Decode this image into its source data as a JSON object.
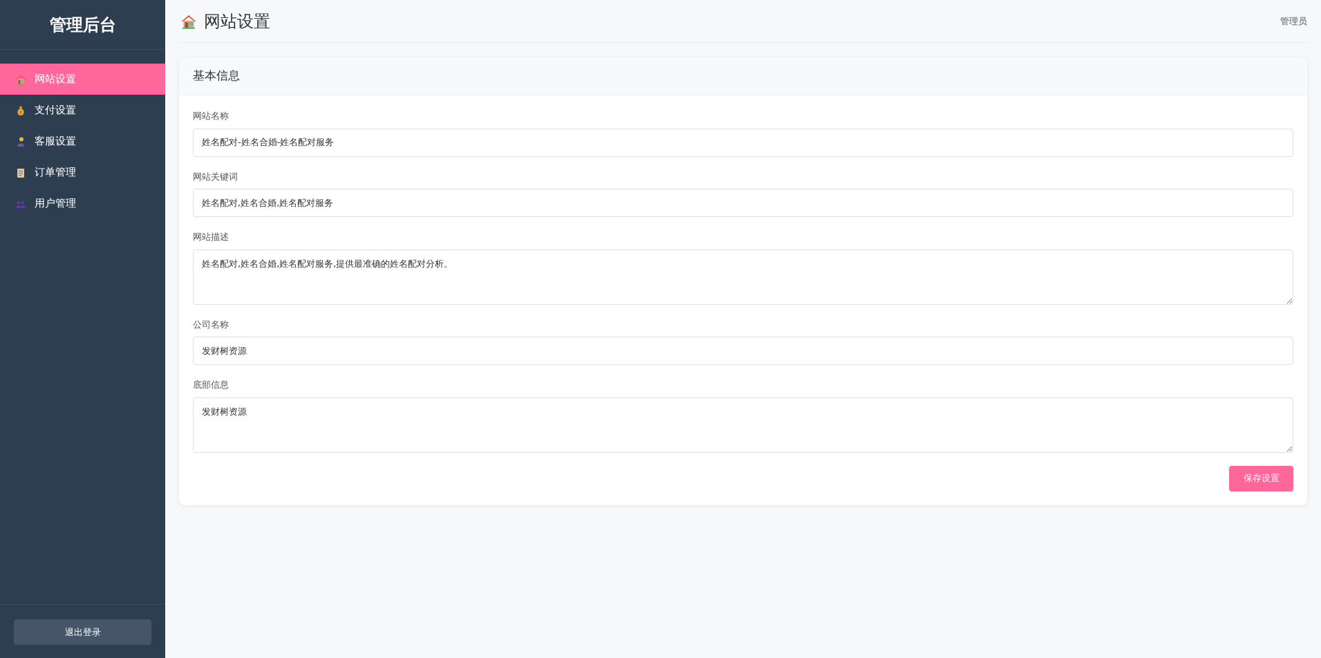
{
  "sidebar": {
    "title": "管理后台",
    "items": [
      {
        "label": "网站设置",
        "selected": true
      },
      {
        "label": "支付设置",
        "selected": false
      },
      {
        "label": "客服设置",
        "selected": false
      },
      {
        "label": "订单管理",
        "selected": false
      },
      {
        "label": "用户管理",
        "selected": false
      }
    ],
    "logout": "退出登录"
  },
  "header": {
    "title": "网站设置",
    "user": "管理员"
  },
  "card": {
    "title": "基本信息",
    "fields": [
      {
        "label": "网站名称",
        "kind": "input",
        "value": "姓名配对-姓名合婚-姓名配对服务"
      },
      {
        "label": "网站关键词",
        "kind": "input",
        "value": "姓名配对,姓名合婚,姓名配对服务"
      },
      {
        "label": "网站描述",
        "kind": "textarea",
        "value": "姓名配对,姓名合婚,姓名配对服务,提供最准确的姓名配对分析。"
      },
      {
        "label": "公司名称",
        "kind": "input",
        "value": "发财树资源"
      },
      {
        "label": "底部信息",
        "kind": "textarea",
        "value": "发财树资源"
      }
    ],
    "save": "保存设置"
  }
}
